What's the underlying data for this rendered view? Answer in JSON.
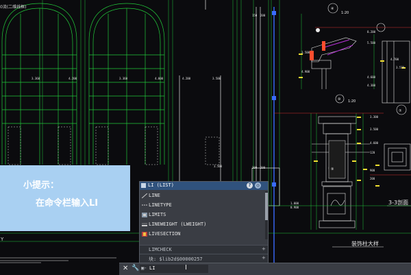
{
  "window": {
    "tab_title": "0流(二维线框)"
  },
  "drawing": {
    "dims": [
      "3.360",
      "4.200",
      "3.360",
      "4.000",
      "4.200",
      "3.500",
      "150",
      "200",
      "3.500",
      "8.200",
      "5.500",
      "4.900",
      "4.600",
      "4.700",
      "3.570",
      "4.300",
      "200",
      "200",
      "3.500",
      "3.300",
      "3.500",
      "4.600",
      "1.000",
      "0.900",
      "120",
      "900",
      "200",
      "1:20",
      "1:20"
    ],
    "section_labels": [
      "3-3剖面",
      "装饰柱大样"
    ],
    "circle_markers": [
      "④",
      "⑩",
      "⑦",
      "⑨"
    ]
  },
  "tip": {
    "line1": "小提示：",
    "line2": "在命令栏输入LI"
  },
  "autocomplete": {
    "header": "LI (LIST)",
    "help_icon": "?",
    "items": [
      {
        "label": "LINE",
        "icon": "line-icon"
      },
      {
        "label": "LINETYPE",
        "icon": "linetype-icon"
      },
      {
        "label": "LIMITS",
        "icon": "limits-icon"
      },
      {
        "label": "LINEWEIGHT (LWEIGHT)",
        "icon": "lineweight-icon"
      },
      {
        "label": "LIVESECTION",
        "icon": "livesection-icon"
      }
    ],
    "groups": [
      {
        "label": "LIMCHECK",
        "expand": "+"
      },
      {
        "label": "块: $lib2d$00000257",
        "expand": "+"
      }
    ]
  },
  "command_line": {
    "close": "✕",
    "wrench": "🔧",
    "prompt": "▣-",
    "value": "LI",
    "cursor": "I"
  },
  "ucs": {
    "label": "Y"
  }
}
